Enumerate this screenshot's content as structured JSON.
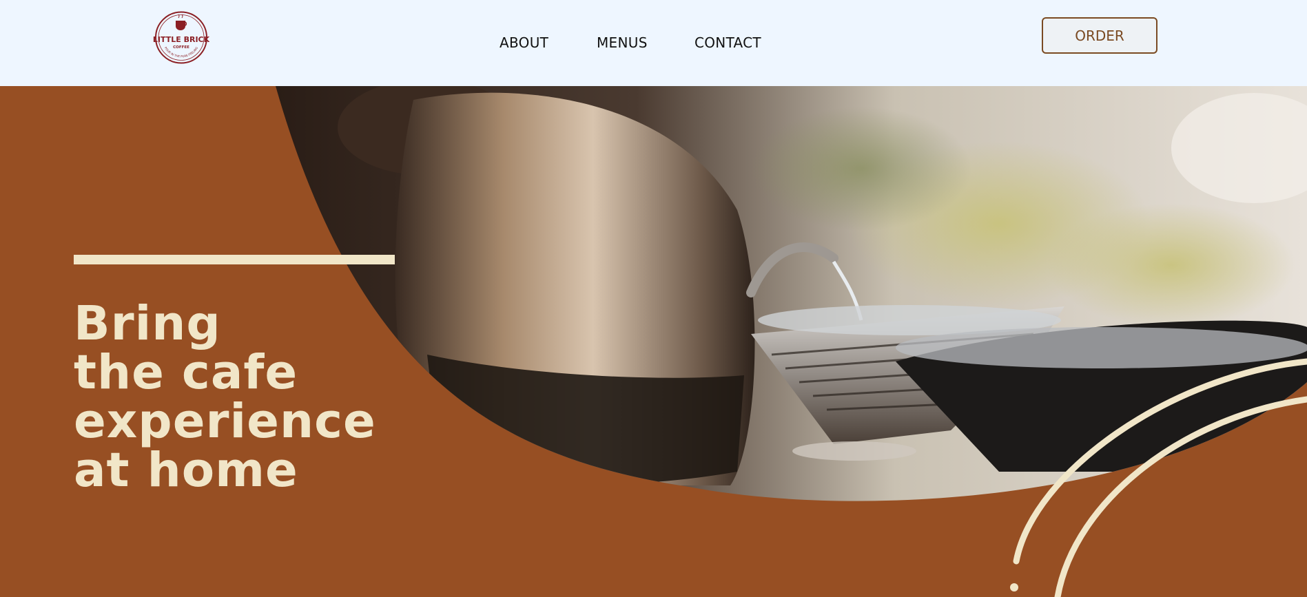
{
  "brand": {
    "logo_line1": "LITTLE BRICK",
    "logo_line2": "COFFEE",
    "logo_tagline": "POUR IN THE PURE FEELING",
    "color": "#8b1f24"
  },
  "nav": {
    "items": [
      {
        "label": "ABOUT"
      },
      {
        "label": "MENUS"
      },
      {
        "label": "CONTACT"
      }
    ]
  },
  "header": {
    "order_label": "ORDER",
    "background": "#eef6ff"
  },
  "hero": {
    "headline_lines": [
      "Bring",
      "the cafe",
      "experience",
      "at home"
    ],
    "background": "#974f23",
    "text_color": "#f1e6c8",
    "photo_subject": "kettle pouring water into pour-over coffee dripper"
  }
}
